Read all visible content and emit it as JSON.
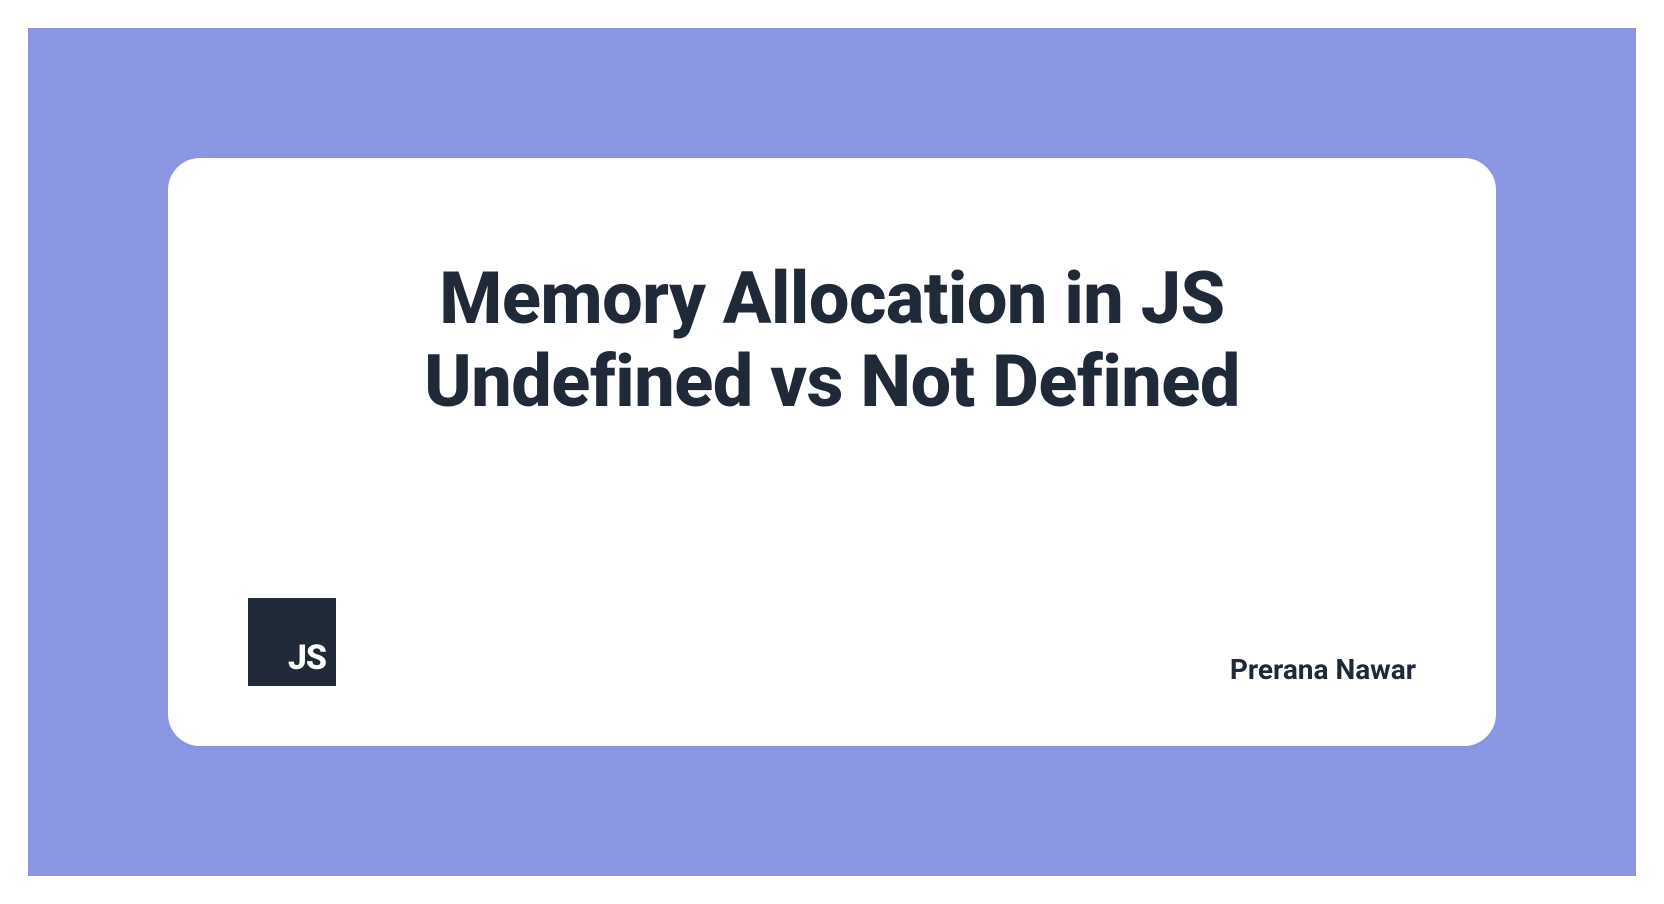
{
  "title_line1": "Memory Allocation in JS",
  "title_line2": "Undefined vs Not Defined",
  "js_badge": "JS",
  "author": "Prerana Nawar",
  "colors": {
    "background_purple": "#8b96e3",
    "text_dark": "#1f2937",
    "card_white": "#ffffff"
  }
}
